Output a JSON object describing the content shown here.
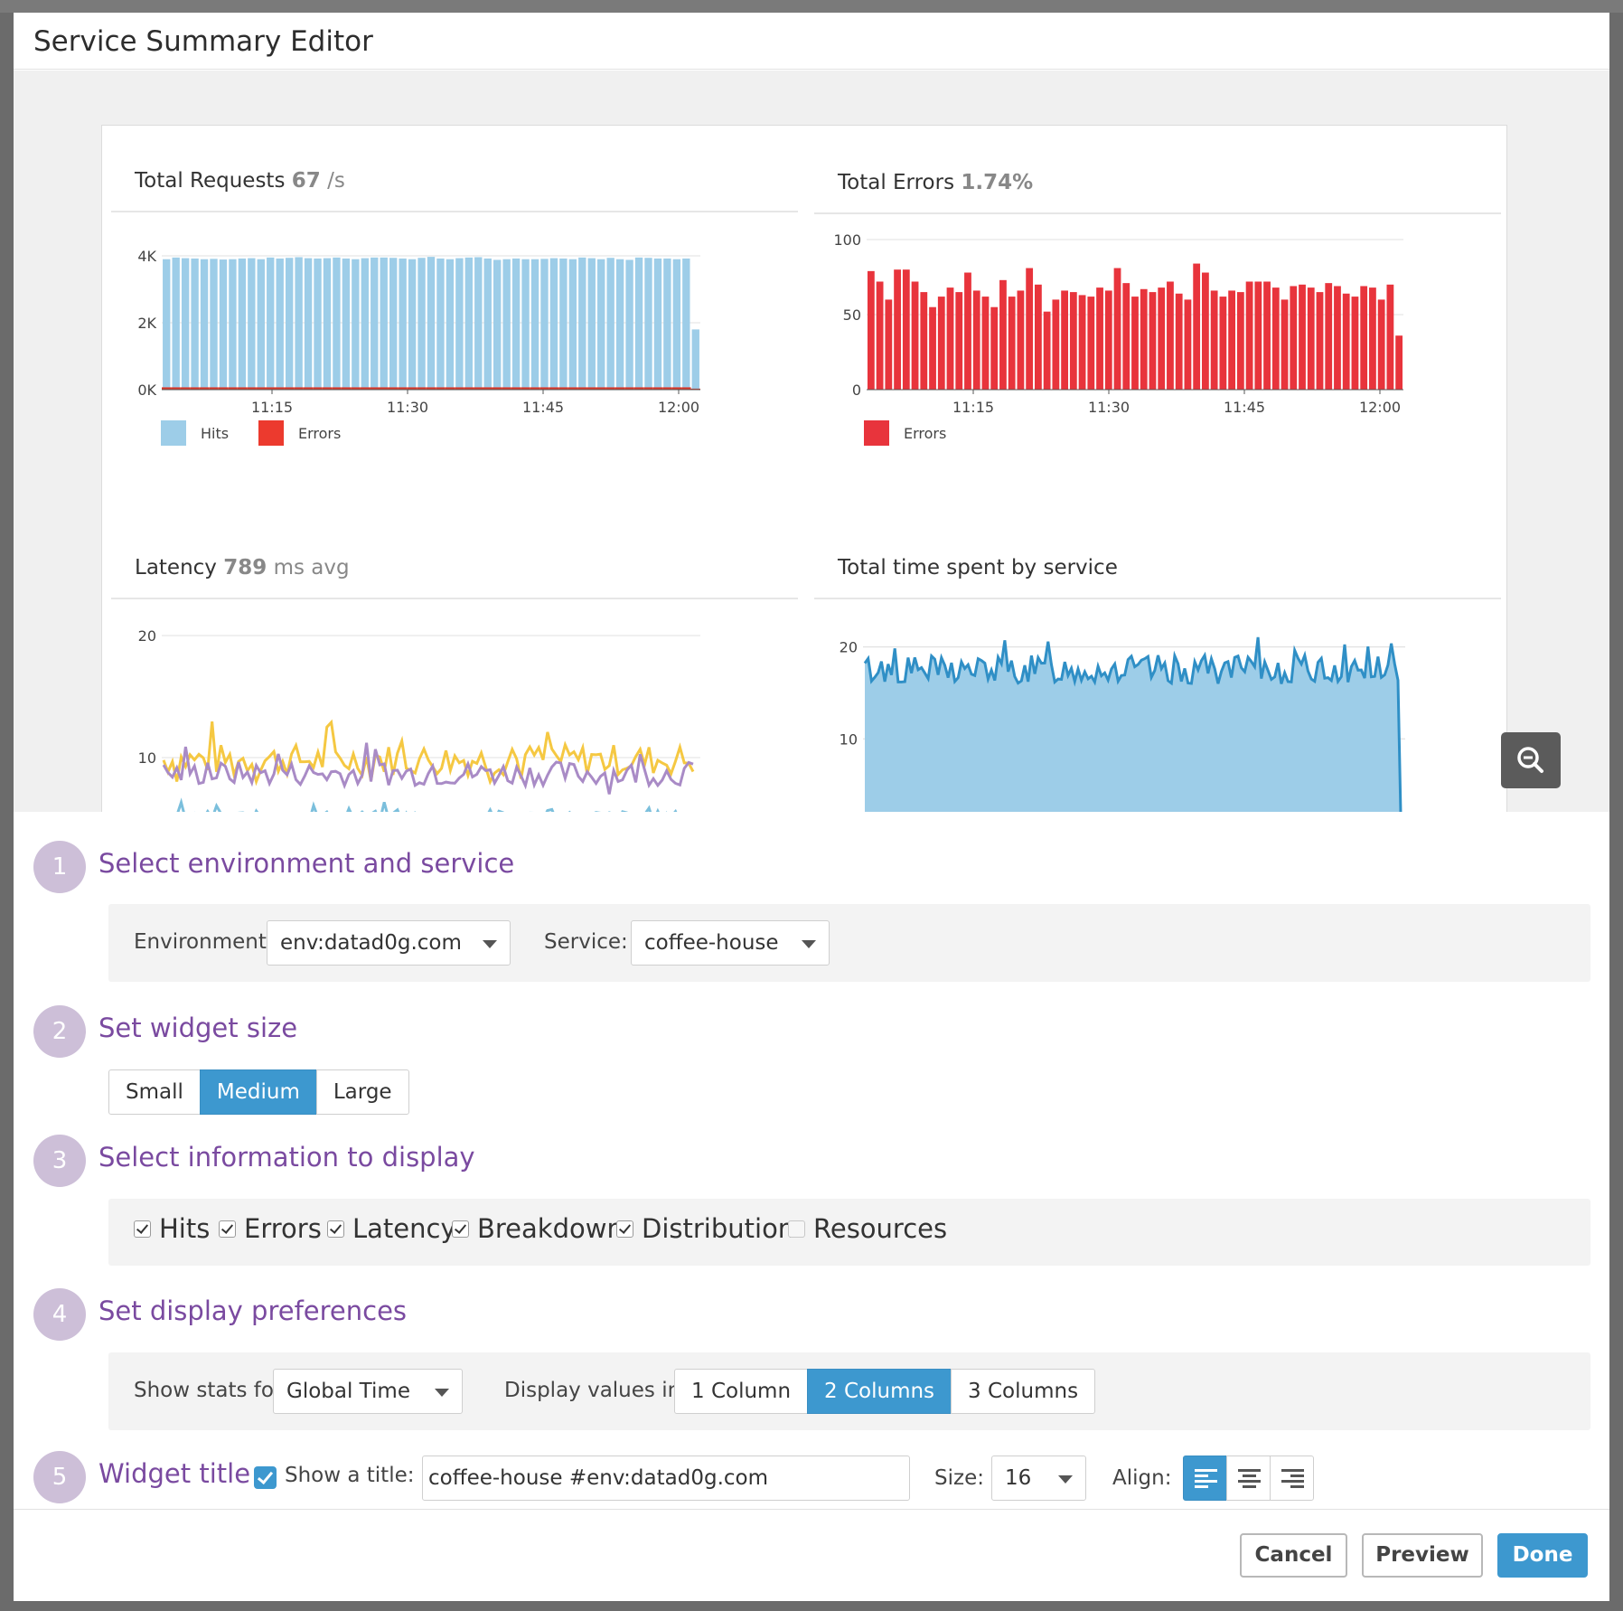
{
  "modal": {
    "title": "Service Summary Editor"
  },
  "colors": {
    "hits": "#9dcde8",
    "errors": "#e8343c",
    "hits_legend_errors": "#ec3a2e",
    "accent": "#3d98cf",
    "step_purple": "#7a4aa0"
  },
  "preview": {
    "requests": {
      "title": "Total Requests",
      "value": "67",
      "unit": "/s"
    },
    "errors": {
      "title": "Total Errors",
      "value": "1.74%"
    },
    "latency": {
      "title": "Latency",
      "value": "789",
      "unit": "ms avg"
    },
    "time_spent": {
      "title": "Total time spent by service"
    }
  },
  "chart_data": [
    {
      "type": "bar",
      "title": "Total Requests 67 /s",
      "y_ticks": [
        "4K",
        "2K",
        "0K"
      ],
      "ylim": [
        0,
        4000
      ],
      "x_ticks": [
        "11:15",
        "11:30",
        "11:45",
        "12:00"
      ],
      "legend": "bottom-left",
      "series": [
        {
          "name": "Hits",
          "values": [
            3900,
            3950,
            3930,
            3920,
            3900,
            3910,
            3890,
            3900,
            3920,
            3930,
            3900,
            3950,
            3920,
            3940,
            3960,
            3930,
            3920,
            3930,
            3950,
            3920,
            3900,
            3930,
            3950,
            3950,
            3940,
            3920,
            3900,
            3940,
            3970,
            3920,
            3900,
            3930,
            3950,
            3960,
            3920,
            3880,
            3900,
            3920,
            3900,
            3900,
            3910,
            3930,
            3920,
            3900,
            3950,
            3930,
            3900,
            3940,
            3900,
            3880,
            3950,
            3940,
            3920,
            3920,
            3900,
            3920,
            1800
          ]
        },
        {
          "name": "Errors",
          "values": [
            70,
            70,
            70,
            70,
            70,
            70,
            70,
            70,
            70,
            70,
            70,
            70,
            70,
            70,
            70,
            70,
            70,
            70,
            70,
            70,
            70,
            70,
            70,
            70,
            70,
            70,
            70,
            70,
            70,
            70,
            70,
            70,
            70,
            70,
            70,
            70,
            70,
            70,
            70,
            70,
            70,
            70,
            70,
            70,
            70,
            70,
            70,
            70,
            70,
            70,
            70,
            70,
            70,
            70,
            70,
            70,
            30
          ]
        }
      ]
    },
    {
      "type": "bar",
      "title": "Total Errors 1.74%",
      "y_ticks": [
        "100",
        "50",
        "0"
      ],
      "ylim": [
        0,
        100
      ],
      "x_ticks": [
        "11:15",
        "11:30",
        "11:45",
        "12:00"
      ],
      "legend": "bottom-left",
      "series": [
        {
          "name": "Errors",
          "values": [
            79,
            72,
            60,
            80,
            80,
            72,
            65,
            55,
            62,
            68,
            65,
            78,
            66,
            62,
            55,
            73,
            62,
            66,
            81,
            70,
            52,
            60,
            66,
            65,
            63,
            62,
            68,
            66,
            81,
            71,
            62,
            67,
            65,
            68,
            72,
            64,
            60,
            84,
            78,
            66,
            62,
            66,
            65,
            72,
            72,
            72,
            68,
            60,
            69,
            70,
            68,
            65,
            71,
            69,
            64,
            62,
            69,
            68,
            60,
            70,
            36
          ]
        }
      ]
    },
    {
      "type": "line",
      "title": "Latency 789 ms avg",
      "y_ticks": [
        "20",
        "10"
      ],
      "ylim": [
        0,
        20
      ],
      "legend": "none"
    },
    {
      "type": "area",
      "title": "Total time spent by service",
      "y_ticks": [
        "20",
        "10"
      ],
      "ylim": [
        0,
        20
      ],
      "legend": "none"
    }
  ],
  "steps": {
    "s1": {
      "num": "1",
      "title": "Select environment and service",
      "env_label": "Environment:",
      "env_value": "env:datad0g.com",
      "service_label": "Service:",
      "service_value": "coffee-house"
    },
    "s2": {
      "num": "2",
      "title": "Set widget size",
      "options": [
        "Small",
        "Medium",
        "Large"
      ],
      "selected": "Medium"
    },
    "s3": {
      "num": "3",
      "title": "Select information to display",
      "checks": [
        {
          "label": "Hits",
          "checked": true
        },
        {
          "label": "Errors",
          "checked": true
        },
        {
          "label": "Latency",
          "checked": true
        },
        {
          "label": "Breakdown",
          "checked": true
        },
        {
          "label": "Distribution",
          "checked": true
        },
        {
          "label": "Resources",
          "checked": false
        }
      ]
    },
    "s4": {
      "num": "4",
      "title": "Set display preferences",
      "stats_label": "Show stats for:",
      "stats_value": "Global Time",
      "display_label": "Display values in:",
      "columns": [
        "1 Column",
        "2 Columns",
        "3 Columns"
      ],
      "selected": "2 Columns"
    },
    "s5": {
      "num": "5",
      "title": "Widget title",
      "show_title_label": "Show a title:",
      "show_title_checked": true,
      "title_value": "coffee-house #env:datad0g.com",
      "size_label": "Size:",
      "size_value": "16",
      "align_label": "Align:",
      "align_selected": "left"
    }
  },
  "footer": {
    "cancel": "Cancel",
    "preview": "Preview",
    "done": "Done"
  }
}
